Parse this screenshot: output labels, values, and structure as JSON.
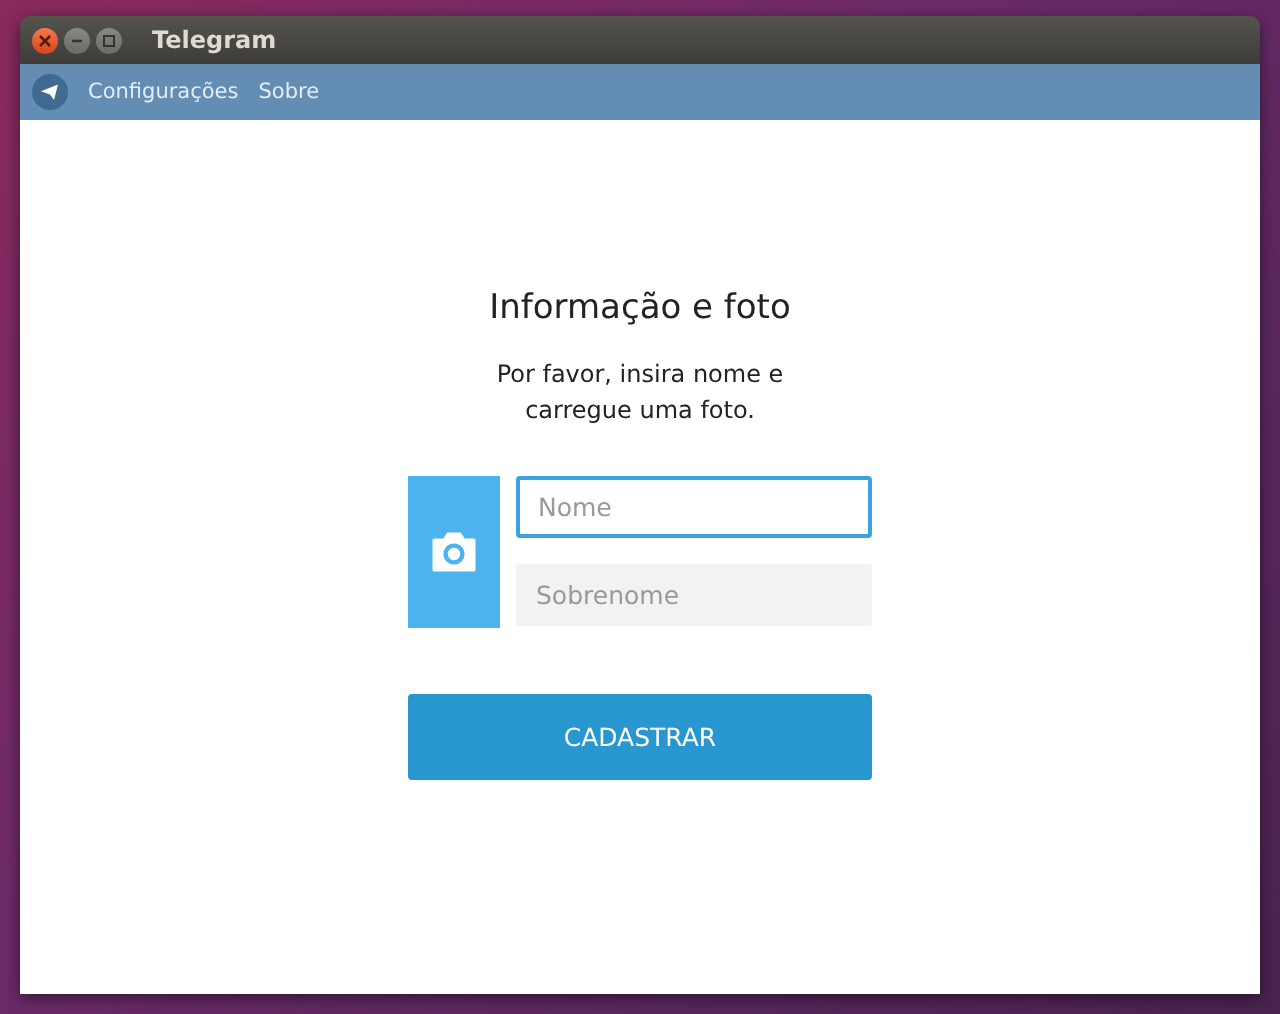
{
  "window": {
    "title": "Telegram"
  },
  "menu": [
    "Configurações",
    "Sobre"
  ],
  "form": {
    "title": "Informação e foto",
    "subtitle": "Por favor, insira nome e carregue uma foto.",
    "fields": [
      {
        "placeholder": "Nome",
        "focused": true
      },
      {
        "placeholder": "Sobrenome",
        "focused": false
      }
    ],
    "submit": "CADASTRAR"
  }
}
